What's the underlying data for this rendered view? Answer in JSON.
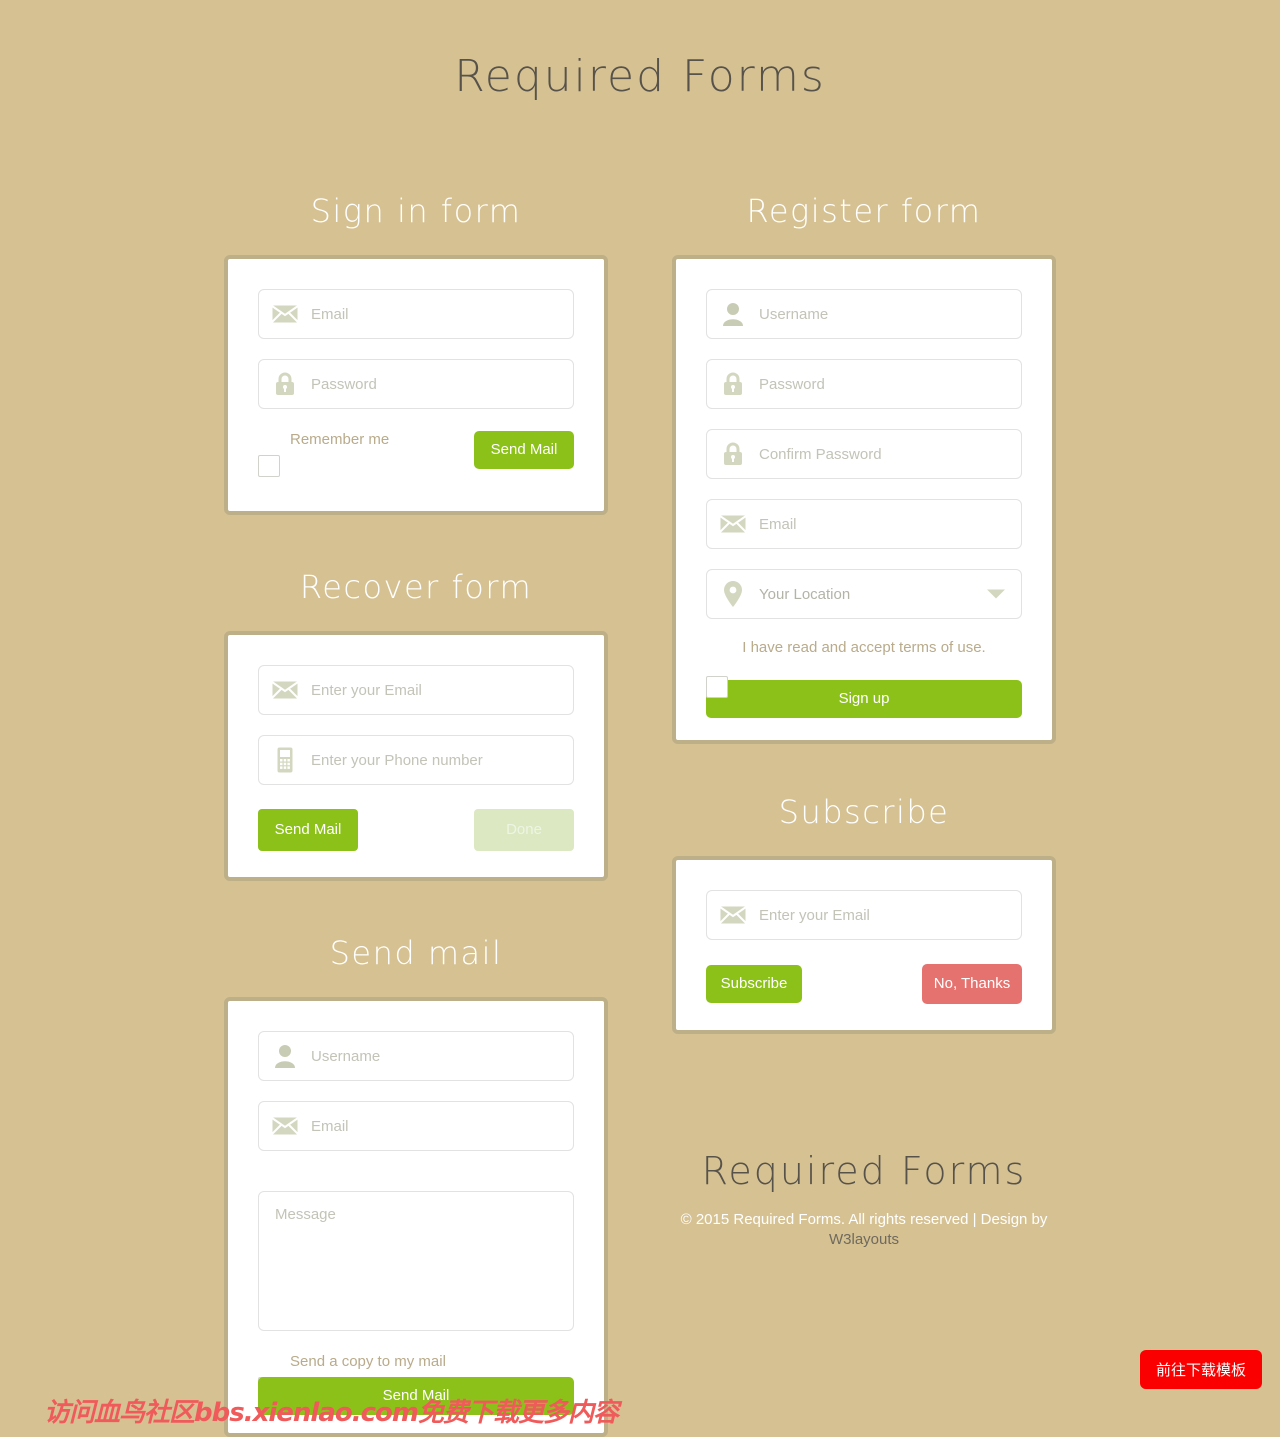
{
  "page": {
    "title": "Required Forms",
    "background_color": "#d6c192",
    "accent_green": "#8cc11a",
    "accent_red": "#e5726f",
    "card_border_color": "#bdaf87"
  },
  "signin": {
    "heading": "Sign in form",
    "email_placeholder": "Email",
    "password_placeholder": "Password",
    "remember_label": "Remember me",
    "submit_label": "Send Mail"
  },
  "recover": {
    "heading": "Recover form",
    "email_placeholder": "Enter your Email",
    "phone_placeholder": "Enter your Phone number",
    "send_label": "Send Mail",
    "done_label": "Done"
  },
  "sendmail": {
    "heading": "Send mail",
    "username_placeholder": "Username",
    "email_placeholder": "Email",
    "message_placeholder": "Message",
    "copy_label": "Send a copy to my mail",
    "submit_label": "Send Mail"
  },
  "register": {
    "heading": "Register form",
    "username_placeholder": "Username",
    "password_placeholder": "Password",
    "confirm_placeholder": "Confirm Password",
    "email_placeholder": "Email",
    "location_placeholder": "Your Location",
    "terms_label": "I have read and accept terms of use.",
    "submit_label": "Sign up"
  },
  "subscribe": {
    "heading": "Subscribe",
    "email_placeholder": "Enter your Email",
    "subscribe_label": "Subscribe",
    "decline_label": "No, Thanks"
  },
  "footer": {
    "logo": "Required Forms",
    "copyright": "© 2015 Required Forms. All rights reserved | Design by",
    "brand": "W3layouts"
  },
  "overlay": {
    "watermark": "访问血鸟社区bbs.xienlao.com免费下载更多内容",
    "download_button": "前往下载模板"
  }
}
